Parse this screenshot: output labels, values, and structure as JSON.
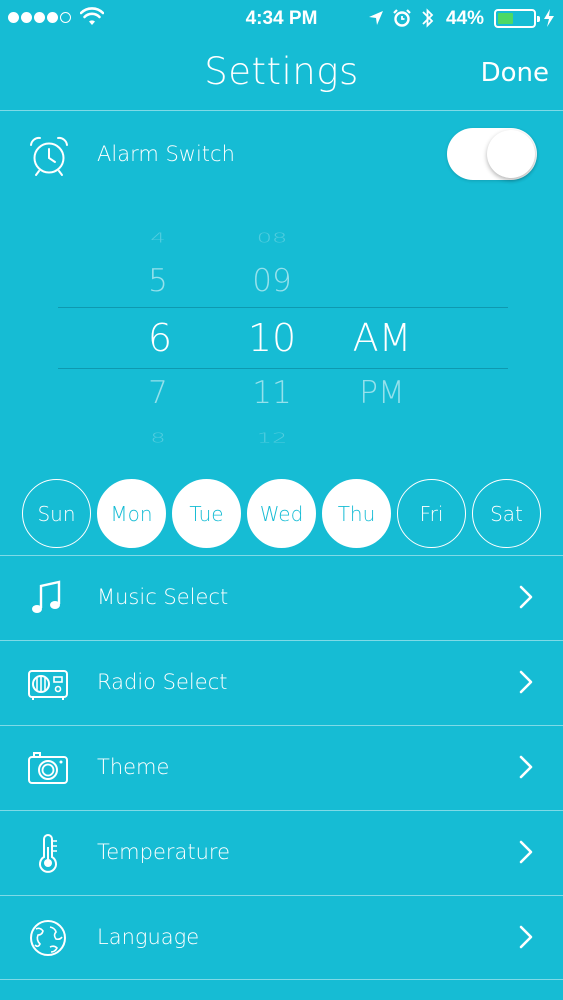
{
  "status_bar": {
    "time": "4:34 PM",
    "battery_percent": "44%",
    "battery_level": 0.44,
    "signal_bars_filled": 4,
    "signal_bars_total": 5
  },
  "nav": {
    "title": "Settings",
    "done_label": "Done"
  },
  "alarm": {
    "label": "Alarm Switch",
    "enabled": true
  },
  "time_picker": {
    "hours": [
      "4",
      "5",
      "6",
      "7",
      "8"
    ],
    "minutes": [
      "08",
      "09",
      "10",
      "11",
      "12"
    ],
    "periods": [
      "AM",
      "PM"
    ],
    "selected_hour": "6",
    "selected_minute": "10",
    "selected_period": "AM"
  },
  "days": [
    {
      "label": "Sun",
      "selected": false
    },
    {
      "label": "Mon",
      "selected": true
    },
    {
      "label": "Tue",
      "selected": true
    },
    {
      "label": "Wed",
      "selected": true
    },
    {
      "label": "Thu",
      "selected": true
    },
    {
      "label": "Fri",
      "selected": false
    },
    {
      "label": "Sat",
      "selected": false
    }
  ],
  "menu": [
    {
      "label": "Music Select",
      "icon": "music-note-icon"
    },
    {
      "label": "Radio Select",
      "icon": "radio-icon"
    },
    {
      "label": "Theme",
      "icon": "camera-icon"
    },
    {
      "label": "Temperature",
      "icon": "thermometer-icon"
    },
    {
      "label": "Language",
      "icon": "globe-icon"
    }
  ],
  "colors": {
    "background": "#16bcd4",
    "foreground": "#ffffff",
    "battery_green": "#4cd964"
  }
}
